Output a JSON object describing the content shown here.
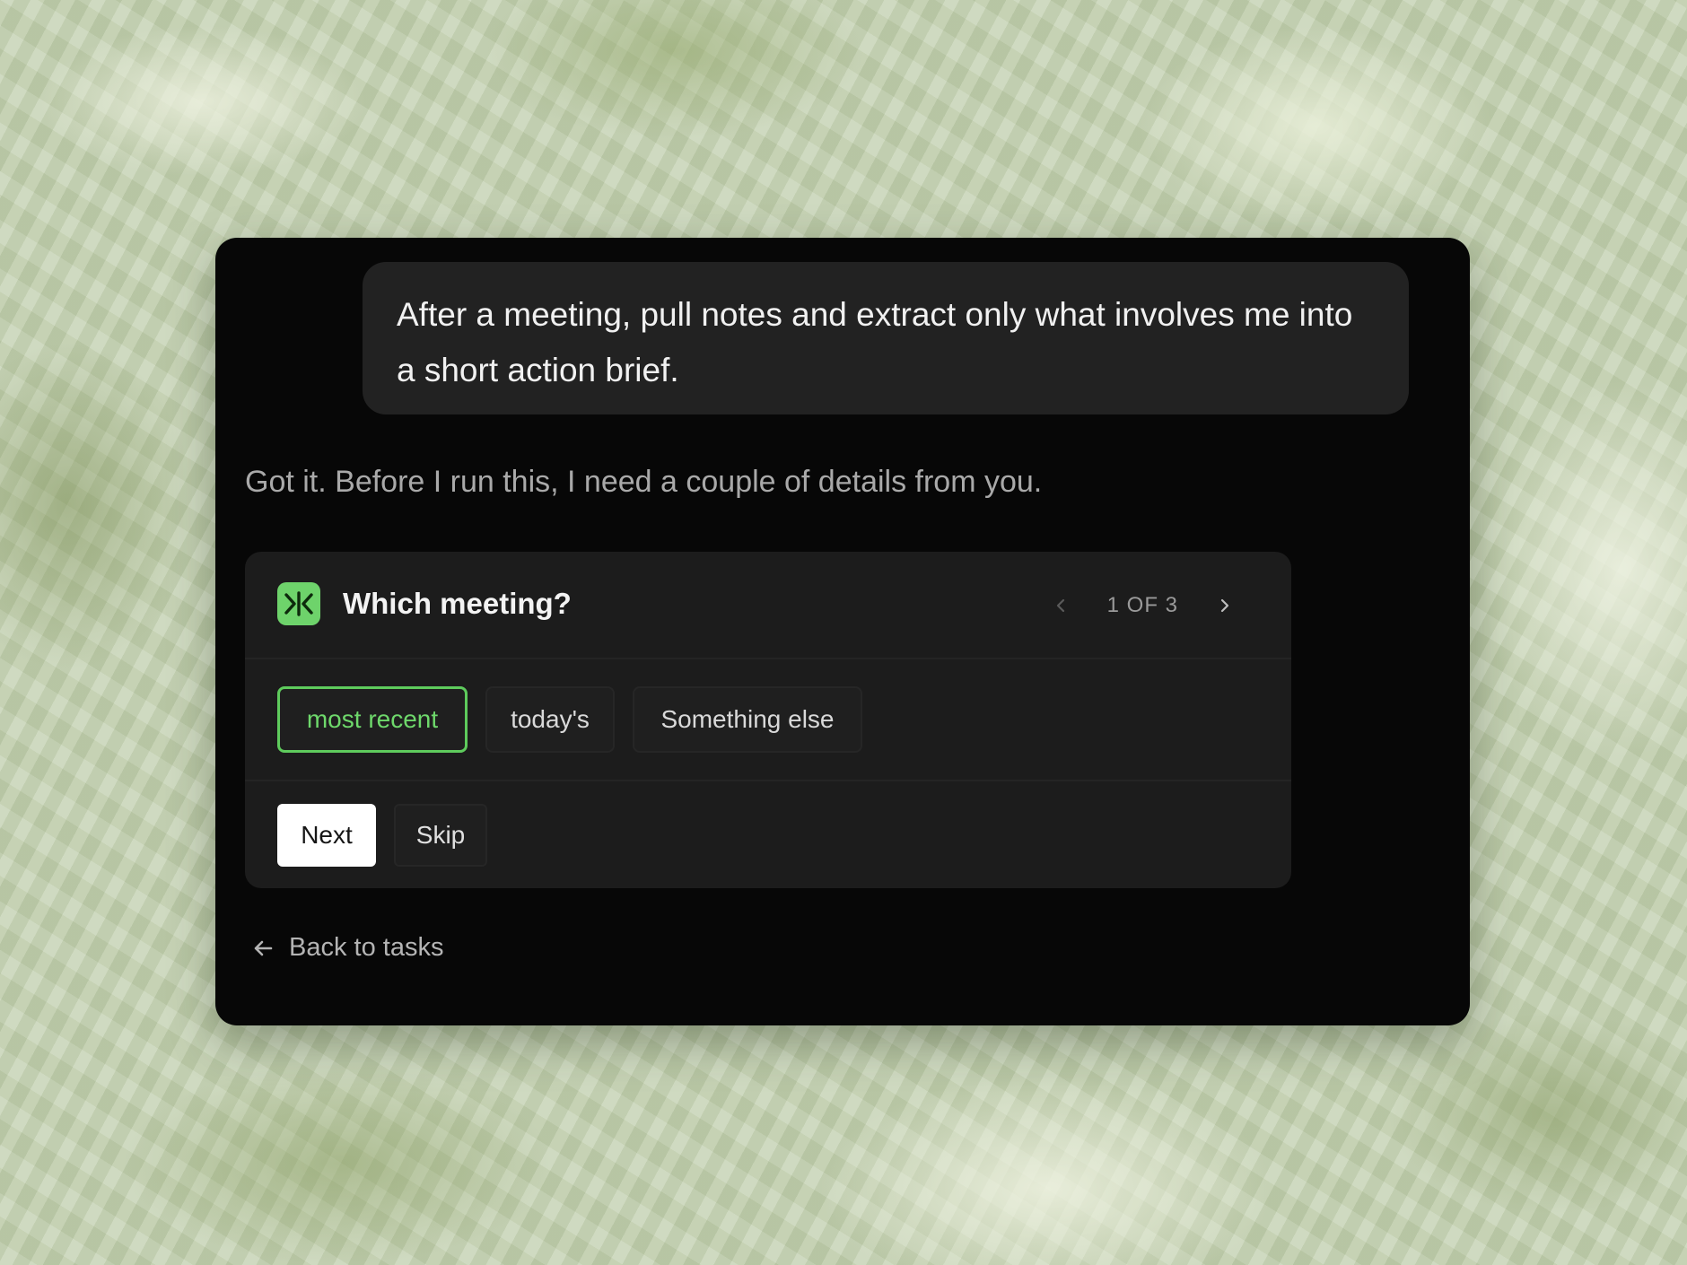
{
  "conversation": {
    "user_message": "After a meeting, pull notes and extract only what involves me into a short action brief.",
    "assistant_message": "Got it. Before I run this, I need a couple of details from you."
  },
  "question_card": {
    "title": "Which meeting?",
    "pager": "1 OF 3",
    "options": [
      {
        "label": "most recent",
        "selected": true
      },
      {
        "label": "today's",
        "selected": false
      },
      {
        "label": "Something else",
        "selected": false
      }
    ],
    "next_label": "Next",
    "skip_label": "Skip"
  },
  "footer": {
    "back_label": "Back to tasks"
  },
  "icons": {
    "logo": "app-logo-icon",
    "prev": "chevron-left-icon",
    "next": "chevron-right-icon",
    "back": "arrow-left-icon"
  },
  "colors": {
    "accent": "#6ed36b",
    "panel": "#070707",
    "card": "#1c1c1c",
    "bubble": "#222222"
  }
}
